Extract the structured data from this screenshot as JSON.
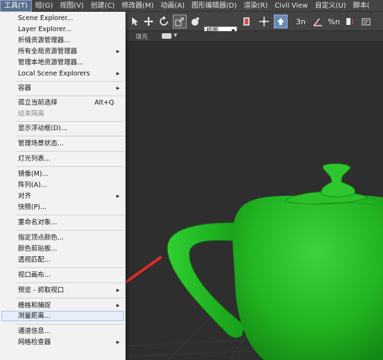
{
  "menubar": {
    "items": [
      "工具(T)",
      "组(G)",
      "视图(V)",
      "创建(C)",
      "修改器(M)",
      "动画(A)",
      "图形编辑器(D)",
      "渲染(R)",
      "Civil View",
      "自定义(U)",
      "脚本("
    ],
    "active_index": 0
  },
  "toolbar": {
    "view_label": "视图",
    "ribbon_tag": "填充",
    "percent_label": "%n",
    "number_label": "3n"
  },
  "dropdown": {
    "items": [
      {
        "label": "Scene Explorer...",
        "submenu": false,
        "shortcut": "",
        "disabled": false
      },
      {
        "label": "Layer Explorer...",
        "submenu": false,
        "shortcut": "",
        "disabled": false
      },
      {
        "label": "折缝资源管理器...",
        "submenu": false,
        "shortcut": "",
        "disabled": false
      },
      {
        "label": "所有全局资源管理器",
        "submenu": true,
        "shortcut": "",
        "disabled": false
      },
      {
        "label": "管理本地资源管理器...",
        "submenu": false,
        "shortcut": "",
        "disabled": false
      },
      {
        "label": "Local Scene Explorers",
        "submenu": true,
        "shortcut": "",
        "disabled": false
      },
      {
        "label": "容器",
        "submenu": true,
        "shortcut": "",
        "disabled": false
      },
      {
        "label": "孤立当前选择",
        "submenu": false,
        "shortcut": "Alt+Q",
        "disabled": false
      },
      {
        "label": "结束隔离",
        "submenu": false,
        "shortcut": "",
        "disabled": true
      },
      {
        "label": "显示浮动框(D)...",
        "submenu": false,
        "shortcut": "",
        "disabled": false
      },
      {
        "label": "管理场景状态...",
        "submenu": false,
        "shortcut": "",
        "disabled": false
      },
      {
        "label": "灯光列表...",
        "submenu": false,
        "shortcut": "",
        "disabled": false
      },
      {
        "label": "镜像(M)...",
        "submenu": false,
        "shortcut": "",
        "disabled": false
      },
      {
        "label": "阵列(A)...",
        "submenu": false,
        "shortcut": "",
        "disabled": false
      },
      {
        "label": "对齐",
        "submenu": true,
        "shortcut": "",
        "disabled": false
      },
      {
        "label": "快照(P)...",
        "submenu": false,
        "shortcut": "",
        "disabled": false
      },
      {
        "label": "重命名对象...",
        "submenu": false,
        "shortcut": "",
        "disabled": false
      },
      {
        "label": "指定顶点颜色...",
        "submenu": false,
        "shortcut": "",
        "disabled": false
      },
      {
        "label": "颜色剪贴板...",
        "submenu": false,
        "shortcut": "",
        "disabled": false
      },
      {
        "label": "透视匹配...",
        "submenu": false,
        "shortcut": "",
        "disabled": false
      },
      {
        "label": "视口画布...",
        "submenu": false,
        "shortcut": "",
        "disabled": false
      },
      {
        "label": "预览 - 抓取视口",
        "submenu": true,
        "shortcut": "",
        "disabled": false
      },
      {
        "label": "栅格和捕捉",
        "submenu": true,
        "shortcut": "",
        "disabled": false
      },
      {
        "label": "测量距离...",
        "submenu": false,
        "shortcut": "",
        "disabled": false
      },
      {
        "label": "通道信息...",
        "submenu": false,
        "shortcut": "",
        "disabled": false
      },
      {
        "label": "网格检查器",
        "submenu": true,
        "shortcut": "",
        "disabled": false
      }
    ],
    "hover_index": 23
  },
  "colors": {
    "teapot": "#22b422",
    "arrow": "#e02a2a"
  }
}
